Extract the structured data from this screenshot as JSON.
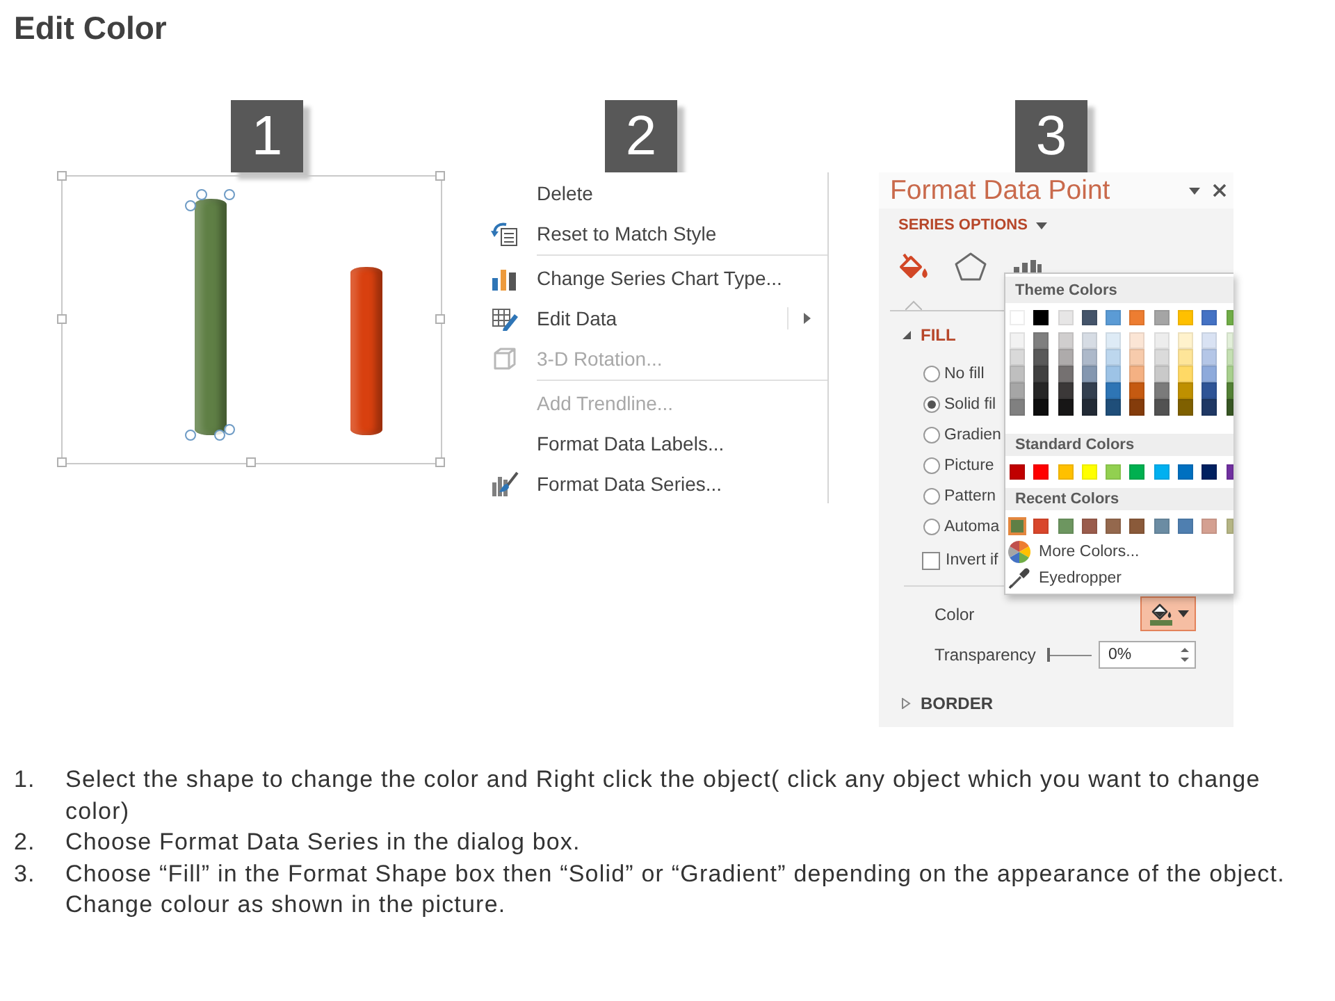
{
  "title": "Edit Color",
  "badges": [
    "1",
    "2",
    "3"
  ],
  "chart": {
    "bars": [
      {
        "color": "#5f7f45",
        "selected": true
      },
      {
        "color": "#d8400f",
        "selected": false
      }
    ]
  },
  "context_menu": {
    "groups": [
      [
        {
          "label": "Delete",
          "disabled": false,
          "submenu": false
        },
        {
          "label": "Reset to Match Style",
          "disabled": false,
          "submenu": false
        }
      ],
      [
        {
          "label": "Change Series Chart Type...",
          "disabled": false,
          "submenu": false
        },
        {
          "label": "Edit Data",
          "disabled": false,
          "submenu": true
        },
        {
          "label": "3-D Rotation...",
          "disabled": true,
          "submenu": false
        }
      ],
      [
        {
          "label": "Add Trendline...",
          "disabled": true,
          "submenu": false
        },
        {
          "label": "Format Data Labels...",
          "disabled": false,
          "submenu": false
        },
        {
          "label": "Format Data Series...",
          "disabled": false,
          "submenu": false
        }
      ]
    ]
  },
  "format_pane": {
    "title": "Format Data Point",
    "options_label": "SERIES OPTIONS",
    "icon_tabs": [
      {
        "selected": true
      },
      {
        "selected": false
      },
      {
        "selected": false
      }
    ],
    "fill": {
      "label": "FILL",
      "expanded": true,
      "options": [
        {
          "label": "No fill",
          "selected": false
        },
        {
          "label": "Solid fil",
          "selected": true
        },
        {
          "label": "Gradien",
          "selected": false
        },
        {
          "label": "Picture",
          "selected": false
        },
        {
          "label": "Pattern",
          "selected": false
        },
        {
          "label": "Automa",
          "selected": false
        }
      ],
      "invert": {
        "label": "Invert if",
        "checked": false
      },
      "color": {
        "label": "Color",
        "open": true,
        "menu": {
          "theme": {
            "title": "Theme Colors",
            "colors": [
              {
                "color": "#ffffff",
                "shades": [
                  {
                    "color": "#f2f2f2"
                  },
                  {
                    "color": "#d9d9d9"
                  },
                  {
                    "color": "#bfbfbf"
                  },
                  {
                    "color": "#a6a6a6"
                  },
                  {
                    "color": "#808080"
                  }
                ]
              },
              {
                "color": "#000000",
                "shades": [
                  {
                    "color": "#7f7f7f"
                  },
                  {
                    "color": "#595959"
                  },
                  {
                    "color": "#404040"
                  },
                  {
                    "color": "#262626"
                  },
                  {
                    "color": "#0d0d0d"
                  }
                ]
              },
              {
                "color": "#e7e6e6",
                "shades": [
                  {
                    "color": "#d0cece"
                  },
                  {
                    "color": "#aeabab"
                  },
                  {
                    "color": "#757171"
                  },
                  {
                    "color": "#3b3838"
                  },
                  {
                    "color": "#171616"
                  }
                ]
              },
              {
                "color": "#44546a",
                "shades": [
                  {
                    "color": "#d6dce4"
                  },
                  {
                    "color": "#adb9ca"
                  },
                  {
                    "color": "#8497b0"
                  },
                  {
                    "color": "#333f4f"
                  },
                  {
                    "color": "#222a35"
                  }
                ]
              },
              {
                "color": "#5b9bd5",
                "shades": [
                  {
                    "color": "#deebf6"
                  },
                  {
                    "color": "#bdd7ee"
                  },
                  {
                    "color": "#9dc3e6"
                  },
                  {
                    "color": "#2e75b5"
                  },
                  {
                    "color": "#1f4e79"
                  }
                ]
              },
              {
                "color": "#ed7d31",
                "shades": [
                  {
                    "color": "#fbe5d5"
                  },
                  {
                    "color": "#f7cbac"
                  },
                  {
                    "color": "#f4b183"
                  },
                  {
                    "color": "#c55a11"
                  },
                  {
                    "color": "#843c0b"
                  }
                ]
              },
              {
                "color": "#a5a5a5",
                "shades": [
                  {
                    "color": "#ededed"
                  },
                  {
                    "color": "#dbdbdb"
                  },
                  {
                    "color": "#c9c9c9"
                  },
                  {
                    "color": "#7b7b7b"
                  },
                  {
                    "color": "#525252"
                  }
                ]
              },
              {
                "color": "#ffc000",
                "shades": [
                  {
                    "color": "#fff2cc"
                  },
                  {
                    "color": "#fee599"
                  },
                  {
                    "color": "#ffd965"
                  },
                  {
                    "color": "#bf9000"
                  },
                  {
                    "color": "#7f6000"
                  }
                ]
              },
              {
                "color": "#4472c4",
                "shades": [
                  {
                    "color": "#d9e2f3"
                  },
                  {
                    "color": "#b4c6e7"
                  },
                  {
                    "color": "#8eaadb"
                  },
                  {
                    "color": "#2f5496"
                  },
                  {
                    "color": "#1f3864"
                  }
                ]
              },
              {
                "color": "#70ad47",
                "shades": [
                  {
                    "color": "#e2efd9"
                  },
                  {
                    "color": "#c5e0b3"
                  },
                  {
                    "color": "#a8d08d"
                  },
                  {
                    "color": "#538135"
                  },
                  {
                    "color": "#375623"
                  }
                ]
              }
            ]
          },
          "standard": {
            "title": "Standard Colors",
            "colors": [
              {
                "color": "#c00000"
              },
              {
                "color": "#ff0000"
              },
              {
                "color": "#ffc000"
              },
              {
                "color": "#ffff00"
              },
              {
                "color": "#92d050"
              },
              {
                "color": "#00b050"
              },
              {
                "color": "#00b0f0"
              },
              {
                "color": "#0070c0"
              },
              {
                "color": "#002060"
              },
              {
                "color": "#7030a0"
              }
            ]
          },
          "recent": {
            "title": "Recent Colors",
            "colors": [
              {
                "color": "#5f7f45",
                "selected": true
              },
              {
                "color": "#d9462b",
                "selected": false
              },
              {
                "color": "#6d9660",
                "selected": false
              },
              {
                "color": "#9a5c4c",
                "selected": false
              },
              {
                "color": "#94684d",
                "selected": false
              },
              {
                "color": "#8a5a3a",
                "selected": false
              },
              {
                "color": "#6b8ca3",
                "selected": false
              },
              {
                "color": "#4f7fb0",
                "selected": false
              },
              {
                "color": "#d4a091",
                "selected": false
              },
              {
                "color": "#b5b584",
                "selected": false
              }
            ]
          },
          "actions": [
            {
              "label": "More Colors..."
            },
            {
              "label": "Eyedropper"
            }
          ]
        }
      },
      "transparency": {
        "label": "Transparency",
        "level": 0,
        "value": "0%"
      }
    },
    "border": {
      "label": "BORDER",
      "expanded": false
    }
  },
  "instructions": [
    {
      "number": "1.",
      "text": "Select the shape to change the color and Right click the object( click any object which you want to change color)"
    },
    {
      "number": "2.",
      "text": "Choose Format Data Series in the dialog box."
    },
    {
      "number": "3.",
      "text": "Choose “Fill” in the Format Shape box then “Solid” or “Gradient” depending on the appearance of the object. Change colour as shown in the picture."
    }
  ]
}
